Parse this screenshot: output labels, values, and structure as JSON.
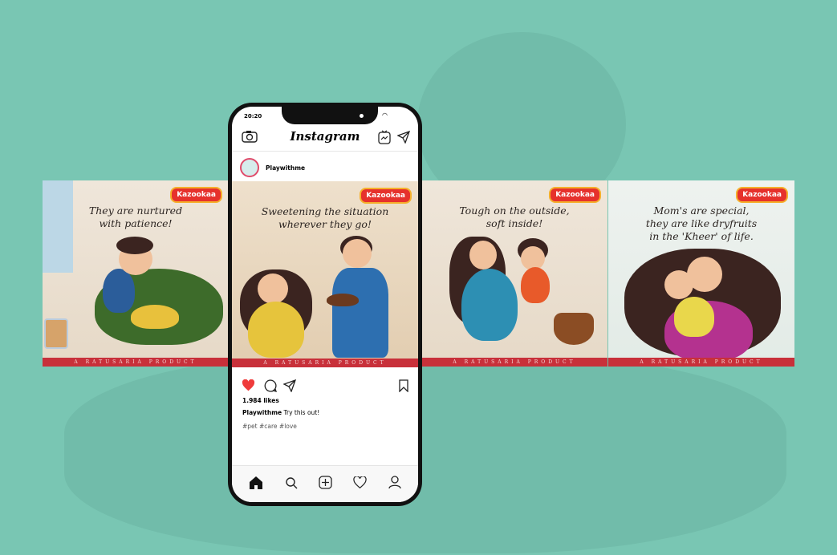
{
  "phone": {
    "time": "20:20",
    "app_title": "Instagram",
    "username": "Playwithme",
    "likes": "1.984 likes",
    "caption_user": "Playwithme",
    "caption_text": "Try this out!",
    "hashtags": "#pet #care #love"
  },
  "brand": "Kazookaa",
  "footer": "A RATUSARIA PRODUCT",
  "cards": [
    {
      "caption": "They are nurtured\nwith patience!"
    },
    {
      "caption": "Sweetening the situation\nwherever they go!"
    },
    {
      "caption": "Tough on the outside,\nsoft inside!"
    },
    {
      "caption": "Mom's are special,\nthey are like dryfruits\nin the 'Kheer' of life."
    }
  ],
  "colors": {
    "background": "#79c6b3",
    "footer": "#c8303a",
    "like": "#ef3b3b"
  }
}
